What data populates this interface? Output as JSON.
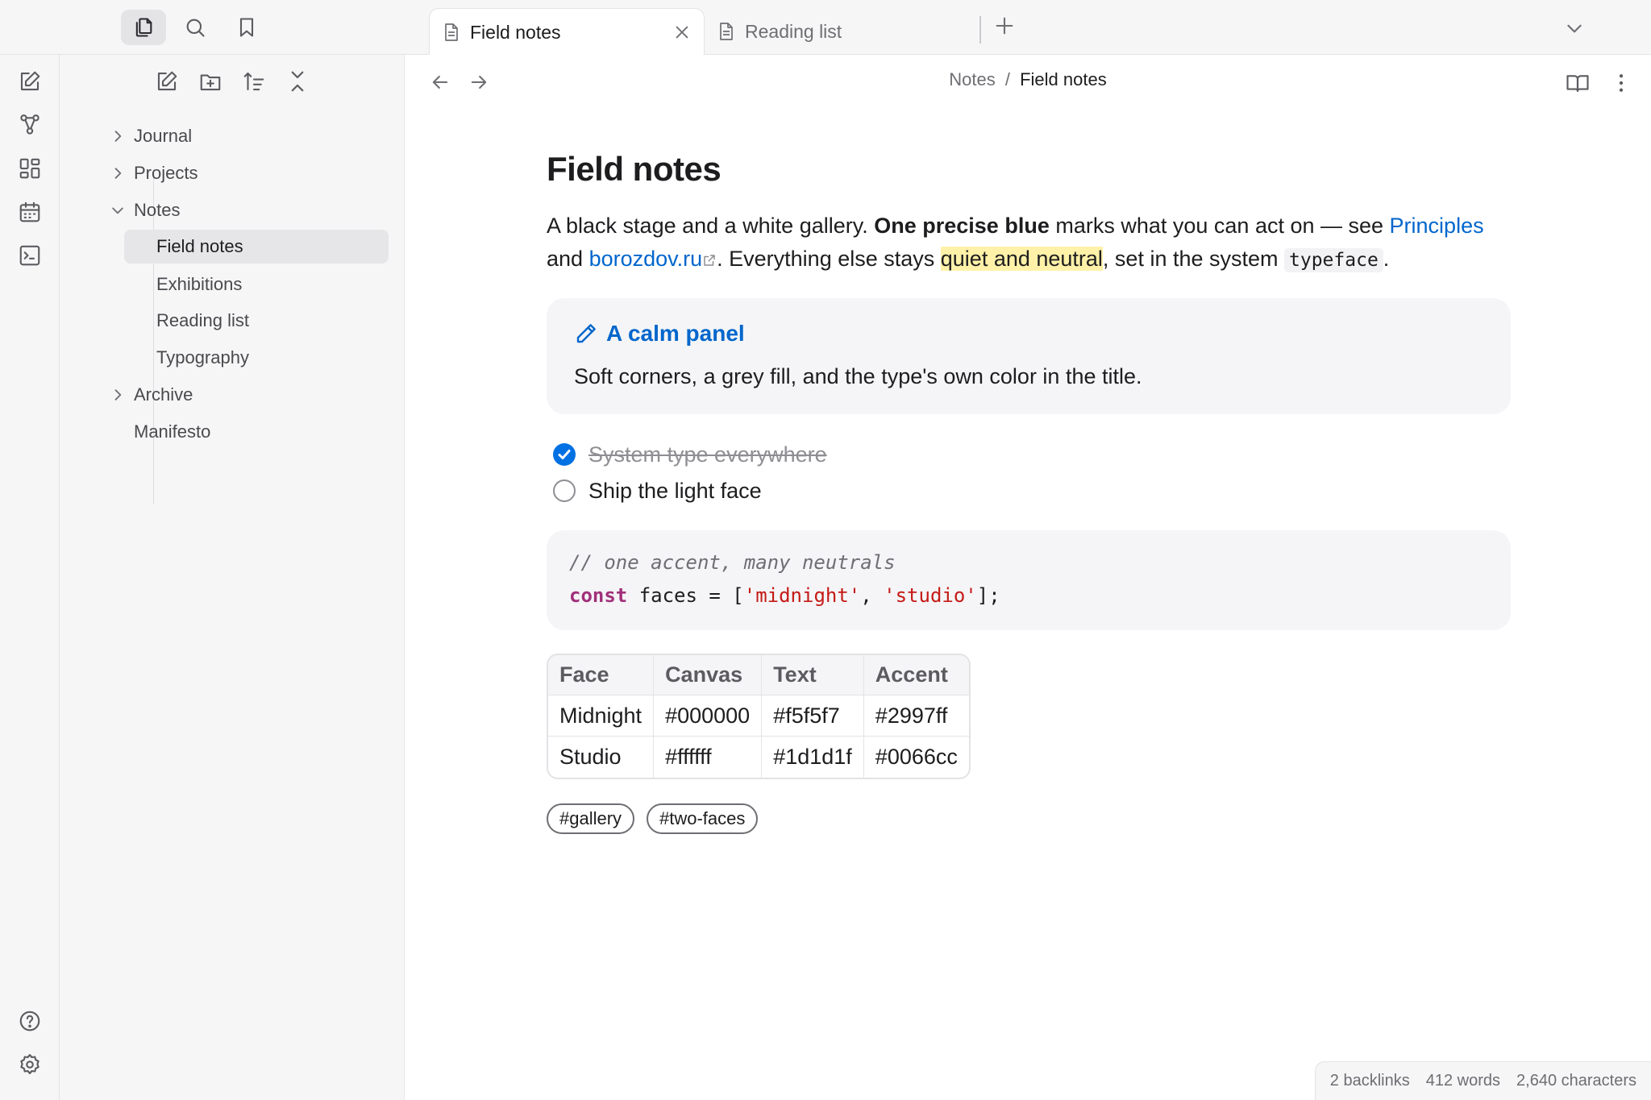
{
  "titlebar": {
    "left_icons": [
      "files-icon",
      "search-icon",
      "bookmark-icon"
    ],
    "tabs": [
      {
        "label": "Field notes",
        "active": true
      },
      {
        "label": "Reading list",
        "active": false
      }
    ]
  },
  "ribbon": {
    "icons": [
      "new-note-icon",
      "graph-icon",
      "canvas-icon",
      "calendar-icon",
      "terminal-icon",
      "help-icon",
      "settings-icon"
    ]
  },
  "sidebar": {
    "tools": [
      "new-note-icon",
      "new-folder-icon",
      "sort-icon",
      "collapse-all-icon"
    ],
    "tree": {
      "journal": "Journal",
      "projects": "Projects",
      "notes": "Notes",
      "field_notes": "Field notes",
      "exhibitions": "Exhibitions",
      "reading_list": "Reading list",
      "typography": "Typography",
      "archive": "Archive",
      "manifesto": "Manifesto"
    }
  },
  "main": {
    "breadcrumb": {
      "parent": "Notes",
      "separator": "/",
      "current": "Field notes"
    },
    "title": "Field notes",
    "para": {
      "t1": "A black stage and a white gallery. ",
      "bold": "One precise blue",
      "t2": " marks what you can act on — see ",
      "link1": "Principles",
      "t3": "and ",
      "link2": "borozdov.ru",
      "t4": ". Everything else stays ",
      "highlight": "quiet and neutral",
      "t5": ", set in the system ",
      "code": "typeface",
      "t6": "."
    },
    "callout": {
      "title": "A calm panel",
      "body": "Soft corners, a grey fill, and the type's own color in the title."
    },
    "tasks": [
      {
        "label": "System type everywhere",
        "done": true
      },
      {
        "label": "Ship the light face",
        "done": false
      }
    ],
    "code": {
      "comment": "// one accent, many neutrals",
      "keyword": "const",
      "ident": " faces = [",
      "str1": "'midnight'",
      "sep": ", ",
      "str2": "'studio'",
      "end": "];"
    },
    "table": {
      "headers": [
        "Face",
        "Canvas",
        "Text",
        "Accent"
      ],
      "rows": [
        [
          "Midnight",
          "#000000",
          "#f5f5f7",
          "#2997ff"
        ],
        [
          "Studio",
          "#ffffff",
          "#1d1d1f",
          "#0066cc"
        ]
      ]
    },
    "tags": [
      "#gallery",
      "#two-faces"
    ],
    "status": {
      "backlinks": "2 backlinks",
      "words": "412 words",
      "characters": "2,640 characters"
    }
  },
  "colors": {
    "accent": "#0066cc",
    "check": "#0071e3",
    "highlight": "#fff1a8",
    "text": "#1d1d1f",
    "muted": "#6e6e73",
    "panel": "#f5f5f7"
  }
}
